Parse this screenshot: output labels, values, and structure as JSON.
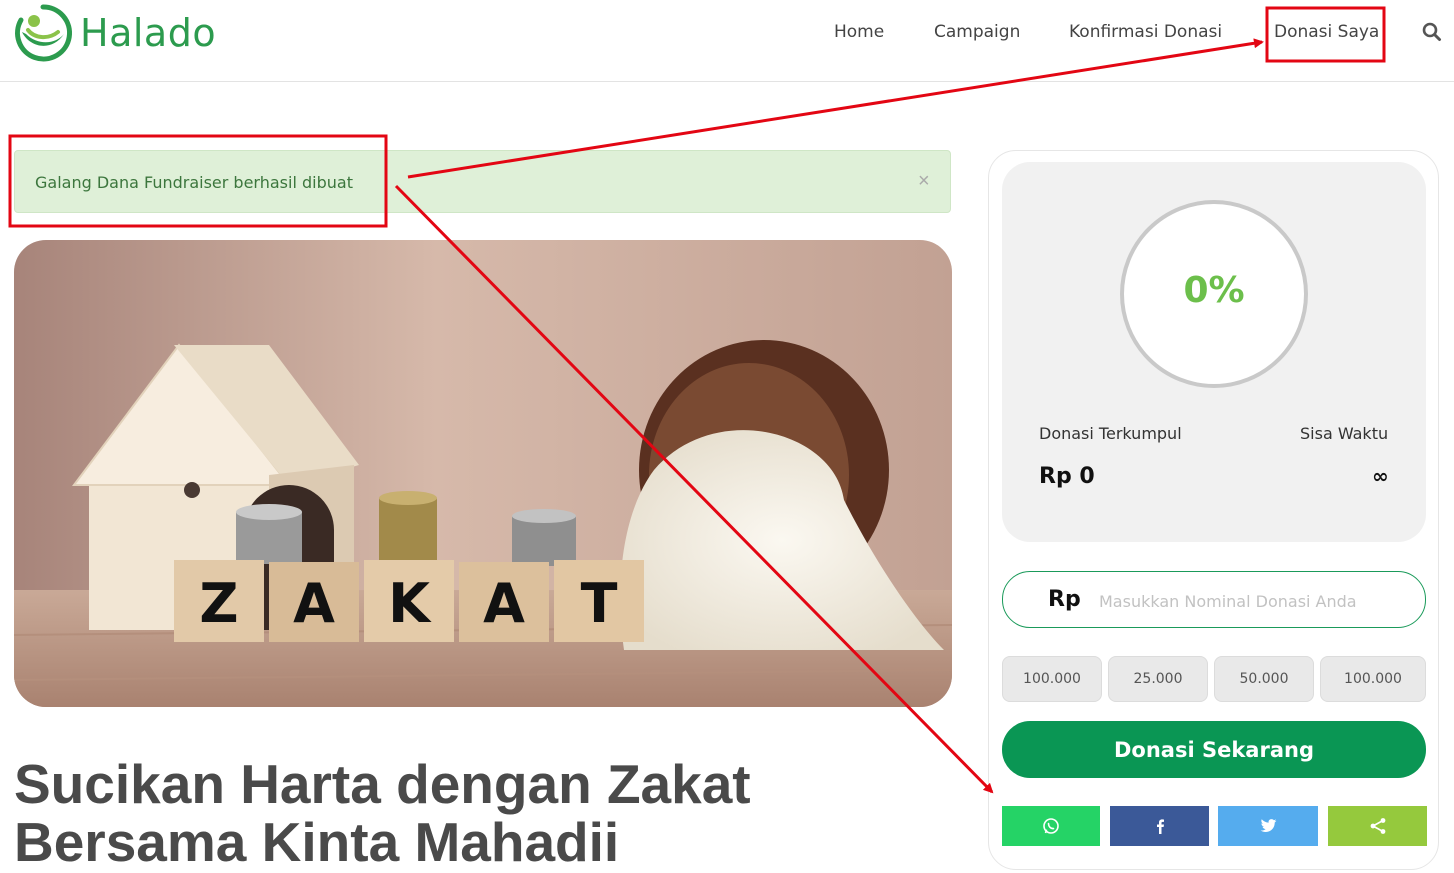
{
  "brand": {
    "name": "Halado"
  },
  "nav": {
    "items": [
      {
        "label": "Home"
      },
      {
        "label": "Campaign"
      },
      {
        "label": "Konfirmasi Donasi"
      },
      {
        "label": "Donasi Saya"
      }
    ],
    "search_icon": "search-icon"
  },
  "alert": {
    "message": "Galang Dana Fundraiser berhasil dibuat",
    "close": "×"
  },
  "hero": {
    "blocks": [
      "Z",
      "A",
      "K",
      "A",
      "T"
    ]
  },
  "campaign": {
    "title": "Sucikan Harta dengan Zakat Bersama Kinta Mahadii"
  },
  "stats": {
    "progress_percent": "0%",
    "collected_label": "Donasi Terkumpul",
    "collected_value": "Rp 0",
    "time_label": "Sisa Waktu",
    "time_value": "∞"
  },
  "donation": {
    "currency": "Rp",
    "placeholder": "Masukkan Nominal Donasi Anda",
    "presets": [
      "100.000",
      "25.000",
      "50.000",
      "100.000"
    ],
    "cta_label": "Donasi Sekarang"
  },
  "share": [
    {
      "name": "whatsapp",
      "color": "#25d366"
    },
    {
      "name": "facebook",
      "color": "#3b5998"
    },
    {
      "name": "twitter",
      "color": "#55acee"
    },
    {
      "name": "share",
      "color": "#95c93d"
    }
  ],
  "annotation_color": "#e30613"
}
